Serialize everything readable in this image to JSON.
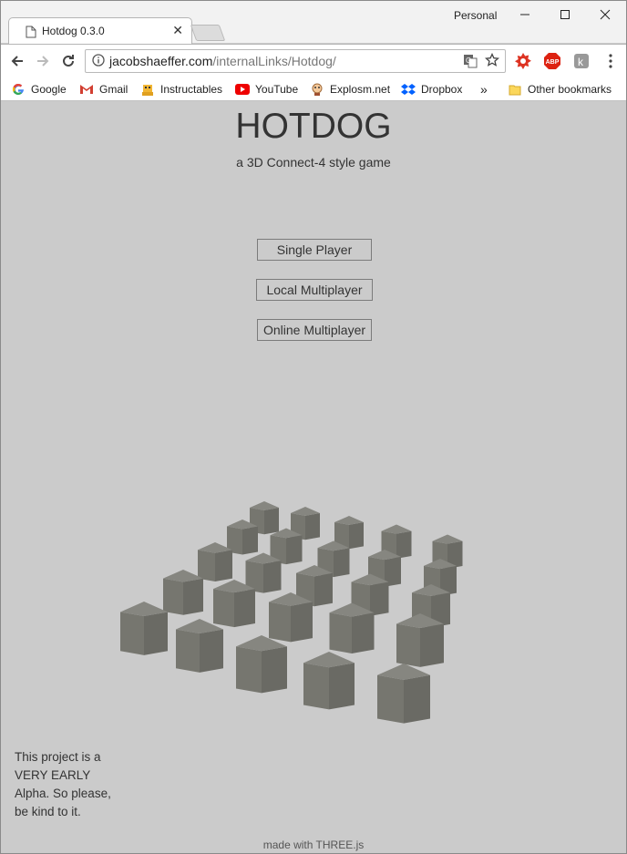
{
  "browser": {
    "profile": "Personal",
    "tab": {
      "title": "Hotdog 0.3.0"
    },
    "url_domain": "jacobshaeffer.com",
    "url_path": "/internalLinks/Hotdog/",
    "bookmarks": [
      "Google",
      "Gmail",
      "Instructables",
      "YouTube",
      "Explosm.net",
      "Dropbox"
    ],
    "overflow": "»",
    "other_bookmarks": "Other bookmarks"
  },
  "page": {
    "title": "HOTDOG",
    "subtitle": "a 3D Connect-4 style game",
    "buttons": [
      "Single Player",
      "Local Multiplayer",
      "Online Multiplayer"
    ],
    "note": "This project is a VERY EARLY Alpha. So please, be kind to it.",
    "credit": "made with THREE.js"
  },
  "colors": {
    "background": "#cbcbcb",
    "cube_top": "#868680",
    "cube_left": "#76766f",
    "cube_right": "#6a6a64"
  }
}
